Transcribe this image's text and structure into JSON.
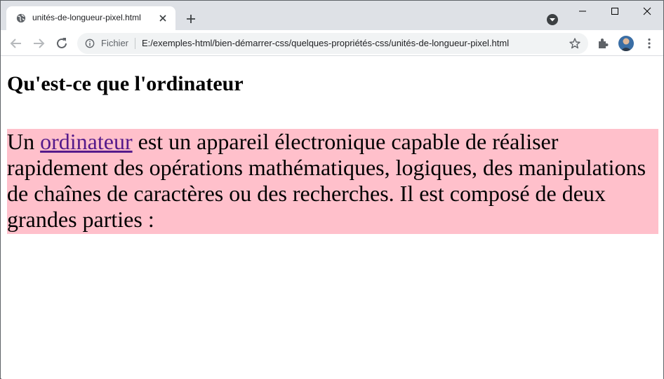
{
  "tab": {
    "title": "unités-de-longueur-pixel.html",
    "globe_icon": "globe-icon",
    "close_icon": "close-icon"
  },
  "toolbar": {
    "scheme_label": "Fichier",
    "url": "E:/exemples-html/bien-démarrer-css/quelques-propriétés-css/unités-de-longueur-pixel.html"
  },
  "page": {
    "heading": "Qu'est-ce que l'ordinateur",
    "para_prefix": "Un ",
    "link_text": "ordinateur",
    "para_rest": " est un appareil électronique capable de réaliser rapidement des opérations mathématiques, logiques, des manipulations de chaînes de caractères ou des recherches. Il est composé de deux grandes parties :",
    "para_background": "#ffc0cb",
    "link_color": "#551a8b"
  },
  "colors": {
    "tabstrip": "#dee1e6",
    "omnibox": "#f1f3f4"
  }
}
